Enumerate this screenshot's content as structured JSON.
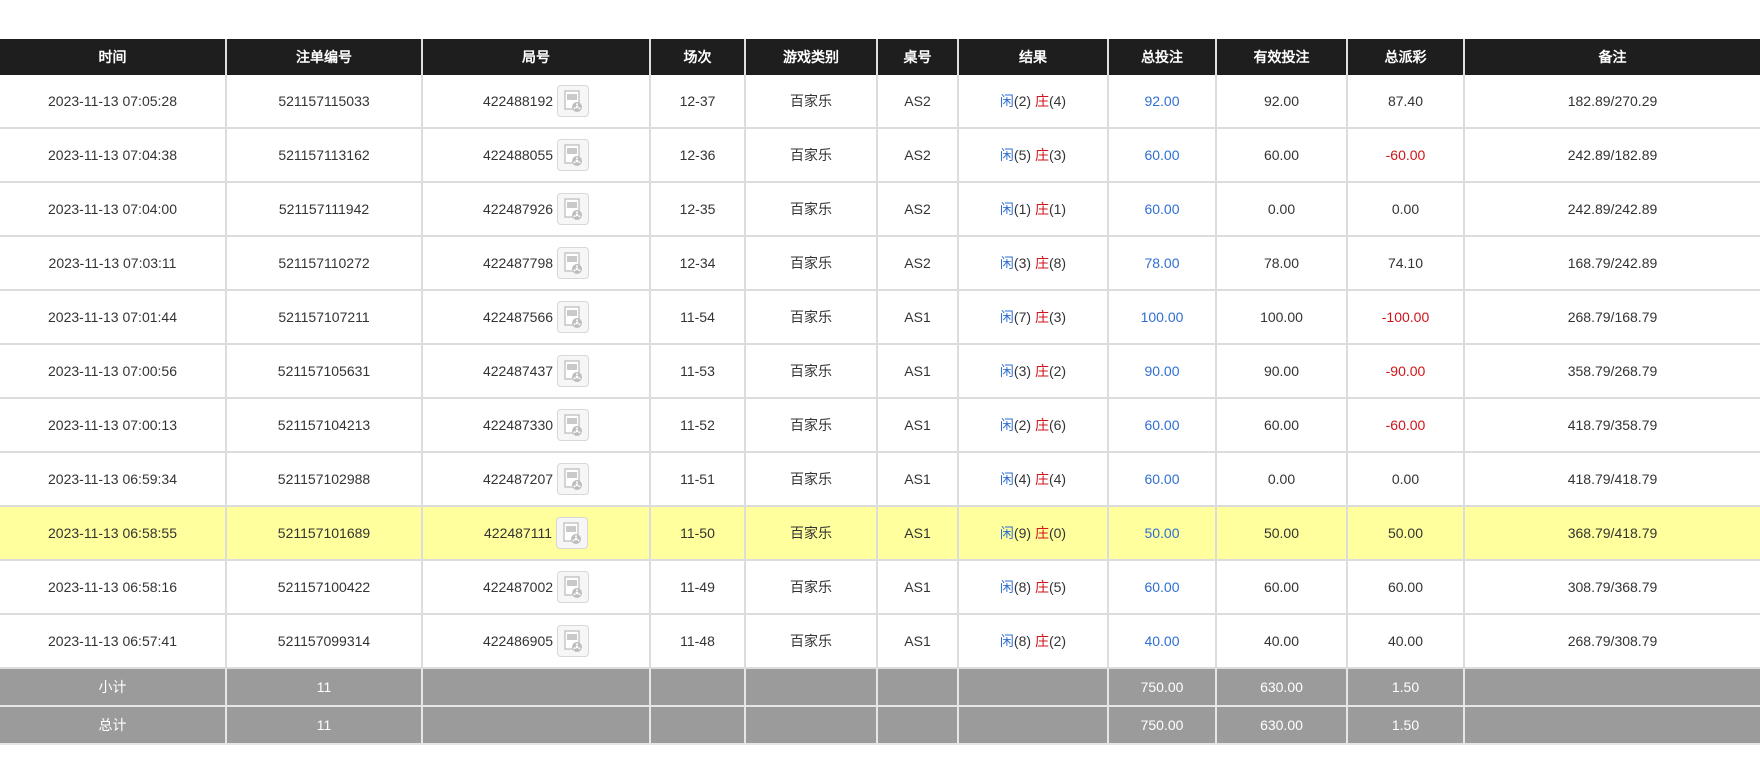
{
  "headers": [
    "时间",
    "注单编号",
    "局号",
    "场次",
    "游戏类别",
    "桌号",
    "结果",
    "总投注",
    "有效投注",
    "总派彩",
    "备注"
  ],
  "rows": [
    {
      "time": "2023-11-13 07:05:28",
      "bet_id": "521157115033",
      "round": "422488192",
      "session": "12-37",
      "game": "百家乐",
      "table": "AS2",
      "p_label": "闲",
      "p_val": "(2)",
      "b_label": "庄",
      "b_val": "(4)",
      "total_bet": "92.00",
      "valid_bet": "92.00",
      "payout": "87.40",
      "payout_neg": false,
      "note": "182.89/270.29",
      "highlight": false
    },
    {
      "time": "2023-11-13 07:04:38",
      "bet_id": "521157113162",
      "round": "422488055",
      "session": "12-36",
      "game": "百家乐",
      "table": "AS2",
      "p_label": "闲",
      "p_val": "(5)",
      "b_label": "庄",
      "b_val": "(3)",
      "total_bet": "60.00",
      "valid_bet": "60.00",
      "payout": "-60.00",
      "payout_neg": true,
      "note": "242.89/182.89",
      "highlight": false
    },
    {
      "time": "2023-11-13 07:04:00",
      "bet_id": "521157111942",
      "round": "422487926",
      "session": "12-35",
      "game": "百家乐",
      "table": "AS2",
      "p_label": "闲",
      "p_val": "(1)",
      "b_label": "庄",
      "b_val": "(1)",
      "total_bet": "60.00",
      "valid_bet": "0.00",
      "payout": "0.00",
      "payout_neg": false,
      "note": "242.89/242.89",
      "highlight": false
    },
    {
      "time": "2023-11-13 07:03:11",
      "bet_id": "521157110272",
      "round": "422487798",
      "session": "12-34",
      "game": "百家乐",
      "table": "AS2",
      "p_label": "闲",
      "p_val": "(3)",
      "b_label": "庄",
      "b_val": "(8)",
      "total_bet": "78.00",
      "valid_bet": "78.00",
      "payout": "74.10",
      "payout_neg": false,
      "note": "168.79/242.89",
      "highlight": false
    },
    {
      "time": "2023-11-13 07:01:44",
      "bet_id": "521157107211",
      "round": "422487566",
      "session": "11-54",
      "game": "百家乐",
      "table": "AS1",
      "p_label": "闲",
      "p_val": "(7)",
      "b_label": "庄",
      "b_val": "(3)",
      "total_bet": "100.00",
      "valid_bet": "100.00",
      "payout": "-100.00",
      "payout_neg": true,
      "note": "268.79/168.79",
      "highlight": false
    },
    {
      "time": "2023-11-13 07:00:56",
      "bet_id": "521157105631",
      "round": "422487437",
      "session": "11-53",
      "game": "百家乐",
      "table": "AS1",
      "p_label": "闲",
      "p_val": "(3)",
      "b_label": "庄",
      "b_val": "(2)",
      "total_bet": "90.00",
      "valid_bet": "90.00",
      "payout": "-90.00",
      "payout_neg": true,
      "note": "358.79/268.79",
      "highlight": false
    },
    {
      "time": "2023-11-13 07:00:13",
      "bet_id": "521157104213",
      "round": "422487330",
      "session": "11-52",
      "game": "百家乐",
      "table": "AS1",
      "p_label": "闲",
      "p_val": "(2)",
      "b_label": "庄",
      "b_val": "(6)",
      "total_bet": "60.00",
      "valid_bet": "60.00",
      "payout": "-60.00",
      "payout_neg": true,
      "note": "418.79/358.79",
      "highlight": false
    },
    {
      "time": "2023-11-13 06:59:34",
      "bet_id": "521157102988",
      "round": "422487207",
      "session": "11-51",
      "game": "百家乐",
      "table": "AS1",
      "p_label": "闲",
      "p_val": "(4)",
      "b_label": "庄",
      "b_val": "(4)",
      "total_bet": "60.00",
      "valid_bet": "0.00",
      "payout": "0.00",
      "payout_neg": false,
      "note": "418.79/418.79",
      "highlight": false
    },
    {
      "time": "2023-11-13 06:58:55",
      "bet_id": "521157101689",
      "round": "422487111",
      "session": "11-50",
      "game": "百家乐",
      "table": "AS1",
      "p_label": "闲",
      "p_val": "(9)",
      "b_label": "庄",
      "b_val": "(0)",
      "total_bet": "50.00",
      "valid_bet": "50.00",
      "payout": "50.00",
      "payout_neg": false,
      "note": "368.79/418.79",
      "highlight": true
    },
    {
      "time": "2023-11-13 06:58:16",
      "bet_id": "521157100422",
      "round": "422487002",
      "session": "11-49",
      "game": "百家乐",
      "table": "AS1",
      "p_label": "闲",
      "p_val": "(8)",
      "b_label": "庄",
      "b_val": "(5)",
      "total_bet": "60.00",
      "valid_bet": "60.00",
      "payout": "60.00",
      "payout_neg": false,
      "note": "308.79/368.79",
      "highlight": false
    },
    {
      "time": "2023-11-13 06:57:41",
      "bet_id": "521157099314",
      "round": "422486905",
      "session": "11-48",
      "game": "百家乐",
      "table": "AS1",
      "p_label": "闲",
      "p_val": "(8)",
      "b_label": "庄",
      "b_val": "(2)",
      "total_bet": "40.00",
      "valid_bet": "40.00",
      "payout": "40.00",
      "payout_neg": false,
      "note": "268.79/308.79",
      "highlight": false
    }
  ],
  "subtotal": {
    "label": "小计",
    "count": "11",
    "total_bet": "750.00",
    "valid_bet": "630.00",
    "payout": "1.50"
  },
  "total": {
    "label": "总计",
    "count": "11",
    "total_bet": "750.00",
    "valid_bet": "630.00",
    "payout": "1.50"
  },
  "colors": {
    "header_bg": "#1e1e1e",
    "highlight": "#ffff9d",
    "blue": "#2f6fd1",
    "red": "#d0141b",
    "summary_bg": "#9b9b9b"
  },
  "icons": {
    "replay": "video-replay-icon"
  }
}
